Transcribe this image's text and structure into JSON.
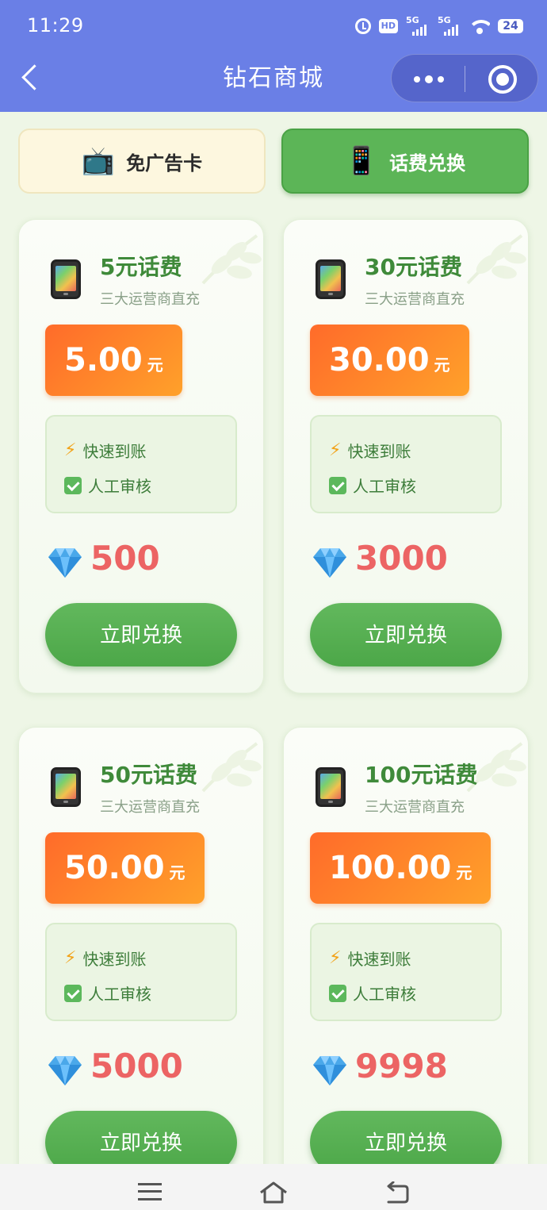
{
  "status_bar": {
    "time": "11:29",
    "hd_badge": "HD",
    "sim1_tag": "5G",
    "sim2_tag": "5G",
    "battery": "24"
  },
  "nav": {
    "title": "钻石商城"
  },
  "tabs": [
    {
      "emoji": "📺",
      "label": "免广告卡",
      "active": false
    },
    {
      "emoji": "📱",
      "label": "话费兑换",
      "active": true
    }
  ],
  "cards": [
    {
      "name": "5元话费",
      "sub": "三大运营商直充",
      "price": "5.00",
      "unit": "元",
      "features": [
        "快速到账",
        "人工审核"
      ],
      "diamonds": "500",
      "button": "立即兑换"
    },
    {
      "name": "30元话费",
      "sub": "三大运营商直充",
      "price": "30.00",
      "unit": "元",
      "features": [
        "快速到账",
        "人工审核"
      ],
      "diamonds": "3000",
      "button": "立即兑换"
    },
    {
      "name": "50元话费",
      "sub": "三大运营商直充",
      "price": "50.00",
      "unit": "元",
      "features": [
        "快速到账",
        "人工审核"
      ],
      "diamonds": "5000",
      "button": "立即兑换"
    },
    {
      "name": "100元话费",
      "sub": "三大运营商直充",
      "price": "100.00",
      "unit": "元",
      "features": [
        "快速到账",
        "人工审核"
      ],
      "diamonds": "9998",
      "button": "立即兑换"
    }
  ],
  "colors": {
    "header_bg": "#6a7fe6",
    "accent_green": "#5cb557",
    "price_orange": "#ff6b2a",
    "diamond_red": "#ec6464"
  },
  "icons": {
    "feature_1": "lightning-icon",
    "feature_2": "check-mark-icon",
    "currency": "diamond-icon"
  }
}
